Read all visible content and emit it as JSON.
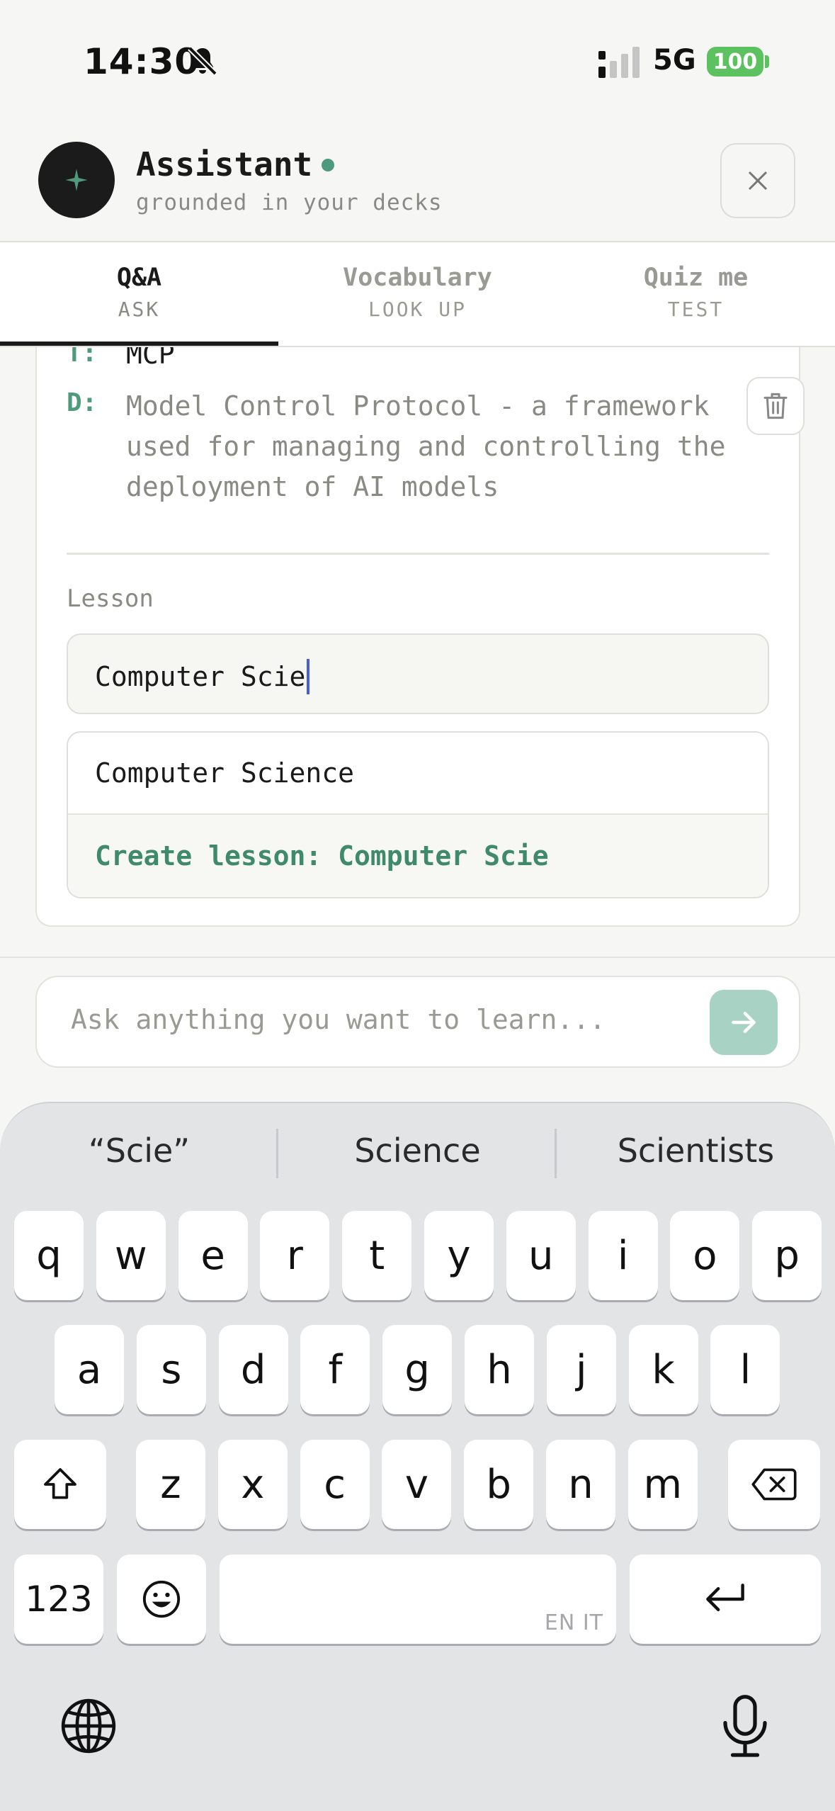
{
  "status_bar": {
    "time": "14:30",
    "network": "5G",
    "battery": "100"
  },
  "header": {
    "title": "Assistant",
    "subtitle": "grounded in your decks"
  },
  "tabs": [
    {
      "label": "Q&A",
      "sub": "ASK",
      "active": true
    },
    {
      "label": "Vocabulary",
      "sub": "LOOK UP",
      "active": false
    },
    {
      "label": "Quiz me",
      "sub": "TEST",
      "active": false
    }
  ],
  "card": {
    "term_key": "T:",
    "term": "MCP",
    "definition_key": "D:",
    "definition": "Model Control Protocol - a framework used for managing and controlling the deployment of AI models",
    "lesson_label": "Lesson",
    "lesson_value": "Computer Scie",
    "suggestions": [
      "Computer Science",
      "Create lesson: Computer Scie"
    ]
  },
  "ask": {
    "placeholder": "Ask anything you want to learn..."
  },
  "keyboard": {
    "suggestions": [
      "“Scie”",
      "Science",
      "Scientists"
    ],
    "row1": [
      "q",
      "w",
      "e",
      "r",
      "t",
      "y",
      "u",
      "i",
      "o",
      "p"
    ],
    "row2": [
      "a",
      "s",
      "d",
      "f",
      "g",
      "h",
      "j",
      "k",
      "l"
    ],
    "row3": [
      "z",
      "x",
      "c",
      "v",
      "b",
      "n",
      "m"
    ],
    "numbers_label": "123",
    "space_tag": "EN IT"
  },
  "colors": {
    "accent": "#4f9a7d",
    "battery": "#5bc25f",
    "send_button": "#a8d3c4",
    "caret": "#4a5ed0"
  }
}
